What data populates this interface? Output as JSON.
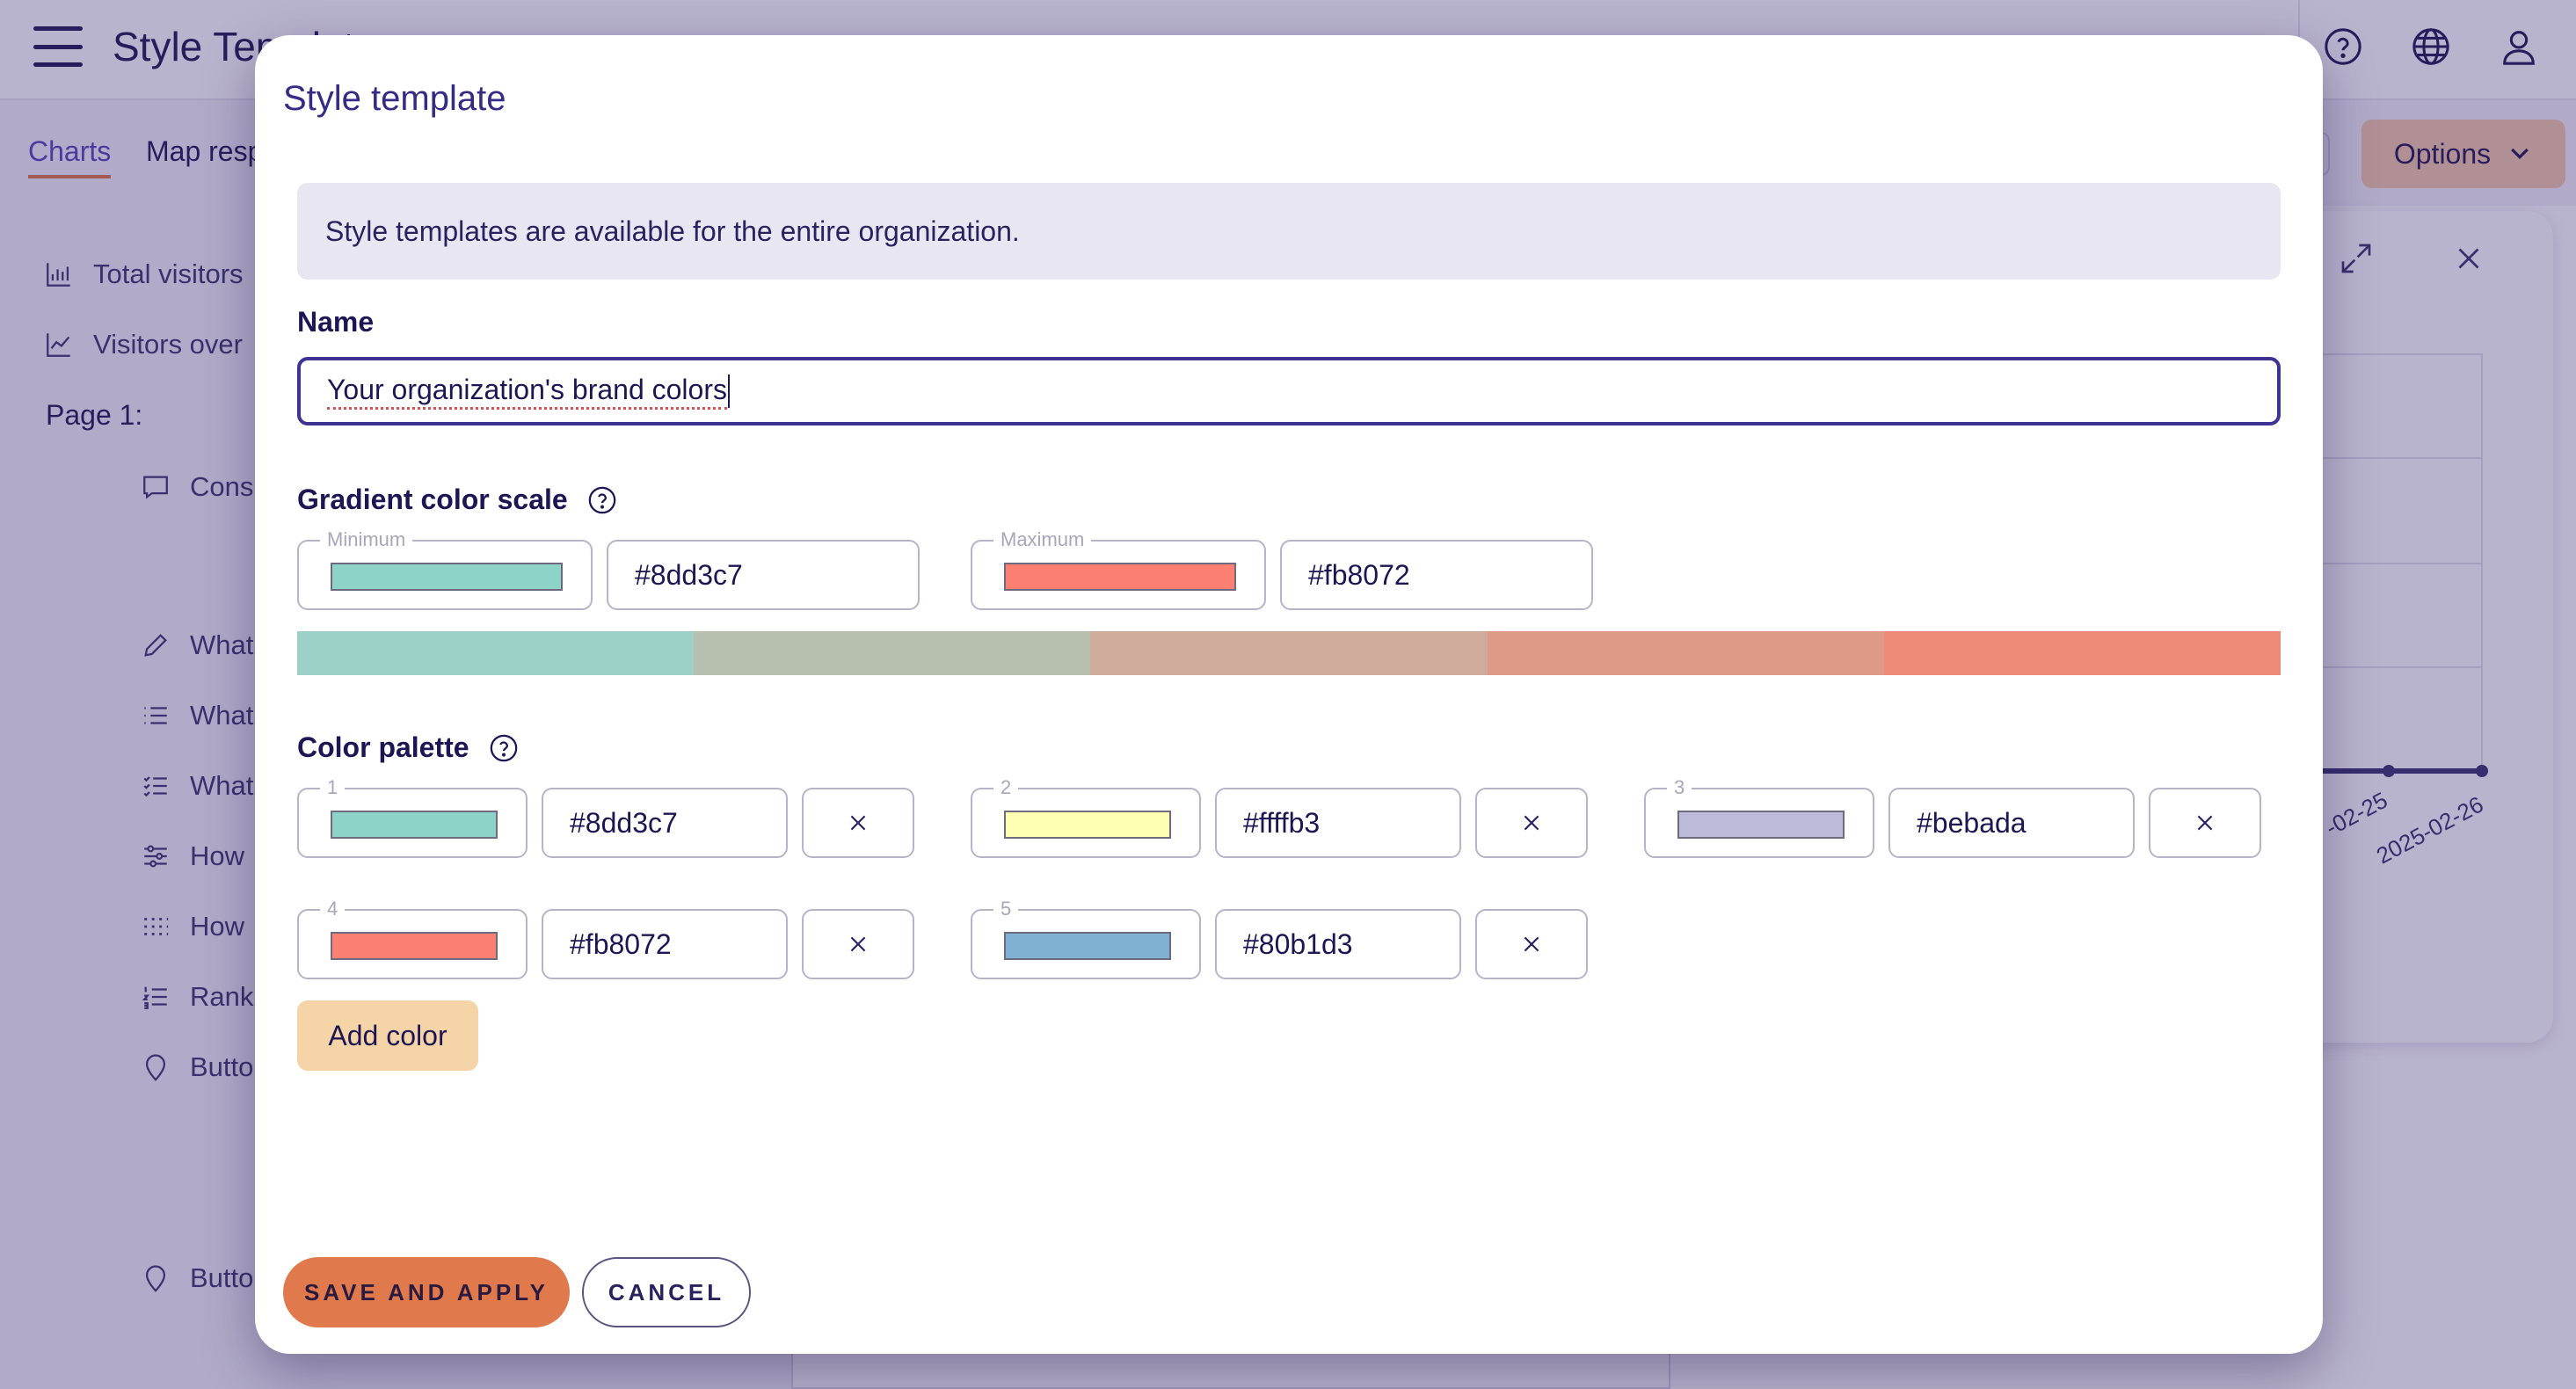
{
  "app": {
    "title": "Style Template",
    "tabs": [
      {
        "label": "Charts"
      },
      {
        "label": "Map resp"
      }
    ],
    "options_label": "Options",
    "sidebar": {
      "items": [
        {
          "label": "Total visitors"
        },
        {
          "label": "Visitors over"
        }
      ],
      "page_label": "Page 1:",
      "questions": [
        {
          "label": "Cons",
          "icon": "comment-icon"
        },
        {
          "label": "What",
          "icon": "pencil-icon"
        },
        {
          "label": "What",
          "icon": "list-icon"
        },
        {
          "label": "What",
          "icon": "checklist-icon"
        },
        {
          "label": "How",
          "icon": "sliders-icon"
        },
        {
          "label": "How",
          "icon": "matrix-icon"
        },
        {
          "label": "Rank",
          "icon": "ranking-icon"
        },
        {
          "label": "Butto",
          "icon": "pin-icon"
        },
        {
          "label": "Butto",
          "icon": "pin-icon"
        }
      ]
    },
    "chart": {
      "dates": [
        "-02-25",
        "2025-02-26"
      ]
    }
  },
  "modal": {
    "title": "Style template",
    "info": "Style templates are available for the entire organization.",
    "name_label": "Name",
    "name_value": "Your organization's brand colors",
    "gradient": {
      "label": "Gradient color scale",
      "min_label": "Minimum",
      "min_value": "#8dd3c7",
      "max_label": "Maximum",
      "max_value": "#fb8072",
      "steps": [
        "#9bd1c6",
        "#b7bfae",
        "#cfab9b",
        "#df9a87",
        "#ed8a77"
      ]
    },
    "palette": {
      "label": "Color palette",
      "colors": [
        {
          "index": "1",
          "hex": "#8dd3c7"
        },
        {
          "index": "2",
          "hex": "#ffffb3"
        },
        {
          "index": "3",
          "hex": "#bebada"
        },
        {
          "index": "4",
          "hex": "#fb8072"
        },
        {
          "index": "5",
          "hex": "#80b1d3"
        }
      ],
      "add_label": "Add color"
    },
    "save_label": "SAVE AND APPLY",
    "cancel_label": "CANCEL"
  }
}
